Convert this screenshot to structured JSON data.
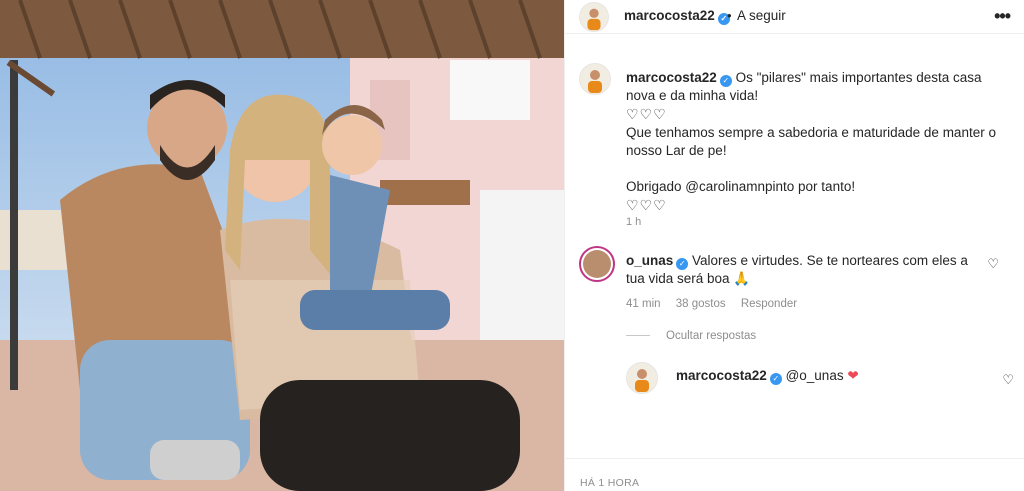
{
  "post": {
    "username": "marcocosta22",
    "dot": "•",
    "follow_label": "A seguir",
    "more_icon": "ellipsis-icon"
  },
  "caption": {
    "username": "marcocosta22",
    "text": "Os \"pilares\" mais importantes desta casa nova e da minha vida!",
    "hearts1": "♡♡♡",
    "text2": "Que tenhamos sempre a sabedoria e maturidade de manter o nosso Lar de pe!",
    "text3": "Obrigado @carolinamnpinto por tanto!",
    "hearts2": "♡♡♡",
    "time": "1 h"
  },
  "comment": {
    "username": "o_unas",
    "text": "Valores e virtudes. Se te norteares com eles a tua vida será boa 🙏",
    "time": "41 min",
    "likes": "38 gostos",
    "reply_label": "Responder"
  },
  "hide_replies_label": "Ocultar respostas",
  "reply": {
    "username": "marcocosta22",
    "text": "@o_unas",
    "heart": "❤"
  },
  "footer_time": "HÁ 1 HORA",
  "colors": {
    "verified": "#3897f0",
    "muted": "#8e8e8e",
    "heart_red": "#ed4956"
  }
}
